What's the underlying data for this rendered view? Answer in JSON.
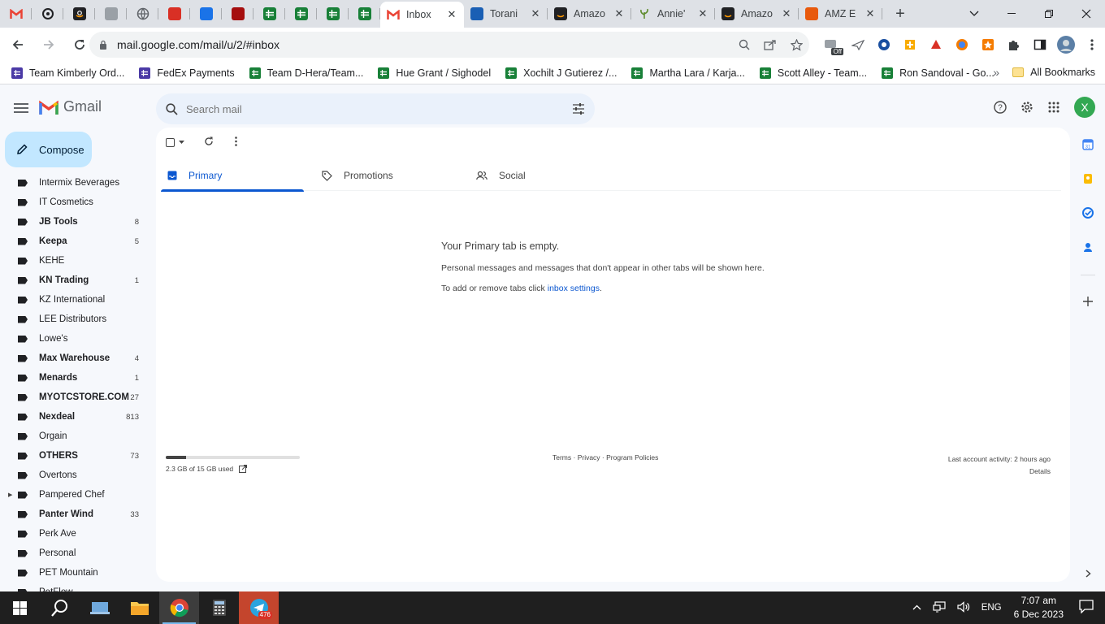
{
  "browser": {
    "pinned_tabs": [
      {
        "icon": "gmail-icon",
        "color": "#ea4335"
      },
      {
        "icon": "openai-icon",
        "color": "#202124"
      },
      {
        "icon": "amazon-icon",
        "color": "#202124"
      },
      {
        "icon": "extension-icon",
        "color": "#9aa0a6"
      },
      {
        "icon": "globe-icon",
        "color": "#5f6368"
      },
      {
        "icon": "app-icon",
        "color": "#d93025"
      },
      {
        "icon": "app-icon",
        "color": "#1a73e8"
      },
      {
        "icon": "app-icon",
        "color": "#a50e0e"
      },
      {
        "icon": "sheets-icon",
        "color": "#188038"
      },
      {
        "icon": "sheets-icon",
        "color": "#188038"
      },
      {
        "icon": "sheets-icon",
        "color": "#188038"
      },
      {
        "icon": "sheets-icon",
        "color": "#188038"
      }
    ],
    "tabs": [
      {
        "title": "Inbox",
        "active": true,
        "icon": "gmail-icon"
      },
      {
        "title": "Torani",
        "active": false,
        "icon": "app-icon"
      },
      {
        "title": "Amazo",
        "active": false,
        "icon": "amazon-icon"
      },
      {
        "title": "Annie'",
        "active": false,
        "icon": "plant-icon"
      },
      {
        "title": "Amazo",
        "active": false,
        "icon": "amazon-icon"
      },
      {
        "title": "AMZ E",
        "active": false,
        "icon": "app-icon"
      }
    ],
    "url": "mail.google.com/mail/u/2/#inbox",
    "extension_badge": "Off",
    "bookmarks": [
      {
        "label": "Team Kimberly Ord...",
        "color": "#4b3aa6"
      },
      {
        "label": "FedEx Payments",
        "color": "#4b3aa6"
      },
      {
        "label": "Team D-Hera/Team...",
        "color": "#188038"
      },
      {
        "label": "Hue Grant / Sighodel",
        "color": "#188038"
      },
      {
        "label": "Xochilt J Gutierez /...",
        "color": "#188038"
      },
      {
        "label": "Martha Lara / Karja...",
        "color": "#188038"
      },
      {
        "label": "Scott Alley - Team...",
        "color": "#188038"
      },
      {
        "label": "Ron Sandoval - Go...",
        "color": "#188038"
      }
    ],
    "all_bookmarks": "All Bookmarks"
  },
  "gmail": {
    "brand": "Gmail",
    "search_placeholder": "Search mail",
    "avatar_letter": "X",
    "compose_label": "Compose",
    "labels": [
      {
        "name": "Intermix Beverages",
        "count": "",
        "bold": false
      },
      {
        "name": "IT Cosmetics",
        "count": "",
        "bold": false
      },
      {
        "name": "JB Tools",
        "count": "8",
        "bold": true
      },
      {
        "name": "Keepa",
        "count": "5",
        "bold": true
      },
      {
        "name": "KEHE",
        "count": "",
        "bold": false
      },
      {
        "name": "KN Trading",
        "count": "1",
        "bold": true
      },
      {
        "name": "KZ International",
        "count": "",
        "bold": false
      },
      {
        "name": "LEE Distributors",
        "count": "",
        "bold": false
      },
      {
        "name": "Lowe's",
        "count": "",
        "bold": false
      },
      {
        "name": "Max Warehouse",
        "count": "4",
        "bold": true
      },
      {
        "name": "Menards",
        "count": "1",
        "bold": true
      },
      {
        "name": "MYOTCSTORE.COM",
        "count": "27",
        "bold": true
      },
      {
        "name": "Nexdeal",
        "count": "813",
        "bold": true
      },
      {
        "name": "Orgain",
        "count": "",
        "bold": false
      },
      {
        "name": "OTHERS",
        "count": "73",
        "bold": true
      },
      {
        "name": "Overtons",
        "count": "",
        "bold": false
      },
      {
        "name": "Pampered Chef",
        "count": "",
        "bold": false,
        "expandable": true
      },
      {
        "name": "Panter Wind",
        "count": "33",
        "bold": true
      },
      {
        "name": "Perk Ave",
        "count": "",
        "bold": false
      },
      {
        "name": "Personal",
        "count": "",
        "bold": false
      },
      {
        "name": "PET Mountain",
        "count": "",
        "bold": false
      },
      {
        "name": "PetFlow",
        "count": "",
        "bold": false
      }
    ],
    "tabs": [
      {
        "label": "Primary",
        "icon": "inbox-icon",
        "active": true
      },
      {
        "label": "Promotions",
        "icon": "tag-icon",
        "active": false
      },
      {
        "label": "Social",
        "icon": "people-icon",
        "active": false
      }
    ],
    "empty_state": {
      "title": "Your Primary tab is empty.",
      "line1": "Personal messages and messages that don't appear in other tabs will be shown here.",
      "line2_prefix": "To add or remove tabs click ",
      "line2_link": "inbox settings",
      "line2_suffix": "."
    },
    "storage": {
      "text": "2.3 GB of 15 GB used",
      "used_fraction": 0.153
    },
    "footer_links": "Terms · Privacy · Program Policies",
    "last_activity": "Last account activity: 2 hours ago",
    "details": "Details"
  },
  "taskbar": {
    "language": "ENG",
    "time": "7:07 am",
    "date": "6 Dec 2023",
    "telegram_badge": "476"
  }
}
